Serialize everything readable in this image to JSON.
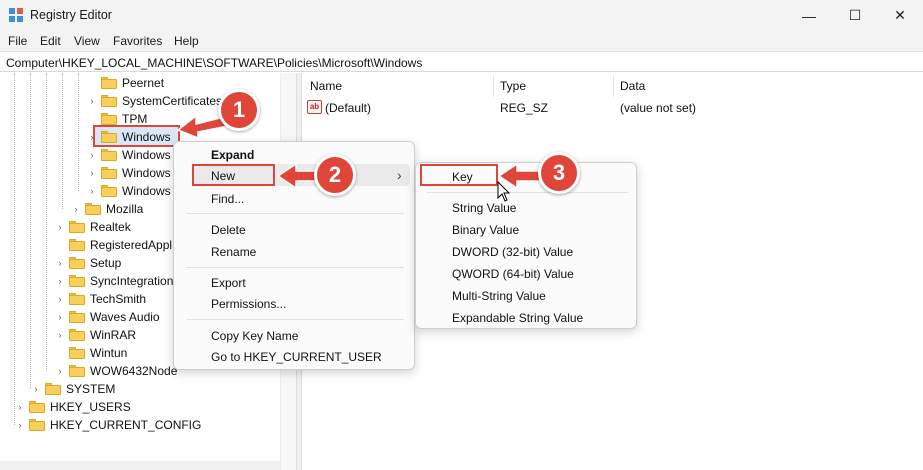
{
  "window": {
    "title": "Registry Editor",
    "min_glyph": "—",
    "max_glyph": "☐",
    "close_glyph": "✕"
  },
  "menu": [
    "File",
    "Edit",
    "View",
    "Favorites",
    "Help"
  ],
  "address": "Computer\\HKEY_LOCAL_MACHINE\\SOFTWARE\\Policies\\Microsoft\\Windows",
  "tree": [
    {
      "label": "Peernet",
      "chev": ""
    },
    {
      "label": "SystemCertificates",
      "chev": "›"
    },
    {
      "label": "TPM",
      "chev": ""
    },
    {
      "label": "Windows",
      "chev": "›"
    },
    {
      "label": "Windows",
      "chev": "›"
    },
    {
      "label": "Windows",
      "chev": "›"
    },
    {
      "label": "Windows",
      "chev": "›"
    },
    {
      "label": "Mozilla",
      "chev": "›"
    },
    {
      "label": "Realtek",
      "chev": "›"
    },
    {
      "label": "RegisteredAppl",
      "chev": ""
    },
    {
      "label": "Setup",
      "chev": "›"
    },
    {
      "label": "SyncIntegration",
      "chev": "›"
    },
    {
      "label": "TechSmith",
      "chev": "›"
    },
    {
      "label": "Waves Audio",
      "chev": "›"
    },
    {
      "label": "WinRAR",
      "chev": "›"
    },
    {
      "label": "Wintun",
      "chev": ""
    },
    {
      "label": "WOW6432Node",
      "chev": "›"
    },
    {
      "label": "SYSTEM",
      "chev": "›"
    },
    {
      "label": "HKEY_USERS",
      "chev": "›"
    },
    {
      "label": "HKEY_CURRENT_CONFIG",
      "chev": "›"
    }
  ],
  "list": {
    "columns": [
      "Name",
      "Type",
      "Data"
    ],
    "rows": [
      {
        "name": "(Default)",
        "type": "REG_SZ",
        "data": "(value not set)",
        "icon": "ab"
      }
    ]
  },
  "context_menu": {
    "expand": "Expand",
    "new": "New",
    "new_arrow": "›",
    "find": "Find...",
    "delete": "Delete",
    "rename": "Rename",
    "export": "Export",
    "permissions": "Permissions...",
    "copy_key_name": "Copy Key Name",
    "goto": "Go to HKEY_CURRENT_USER"
  },
  "submenu": {
    "items": [
      "Key",
      "String Value",
      "Binary Value",
      "DWORD (32-bit) Value",
      "QWORD (64-bit) Value",
      "Multi-String Value",
      "Expandable String Value"
    ]
  },
  "callouts": [
    "1",
    "2",
    "3"
  ],
  "colors": {
    "accent_red": "#e0453a",
    "folder_yellow": "#f7cf5a",
    "selection_blue": "#d9e8f8"
  }
}
